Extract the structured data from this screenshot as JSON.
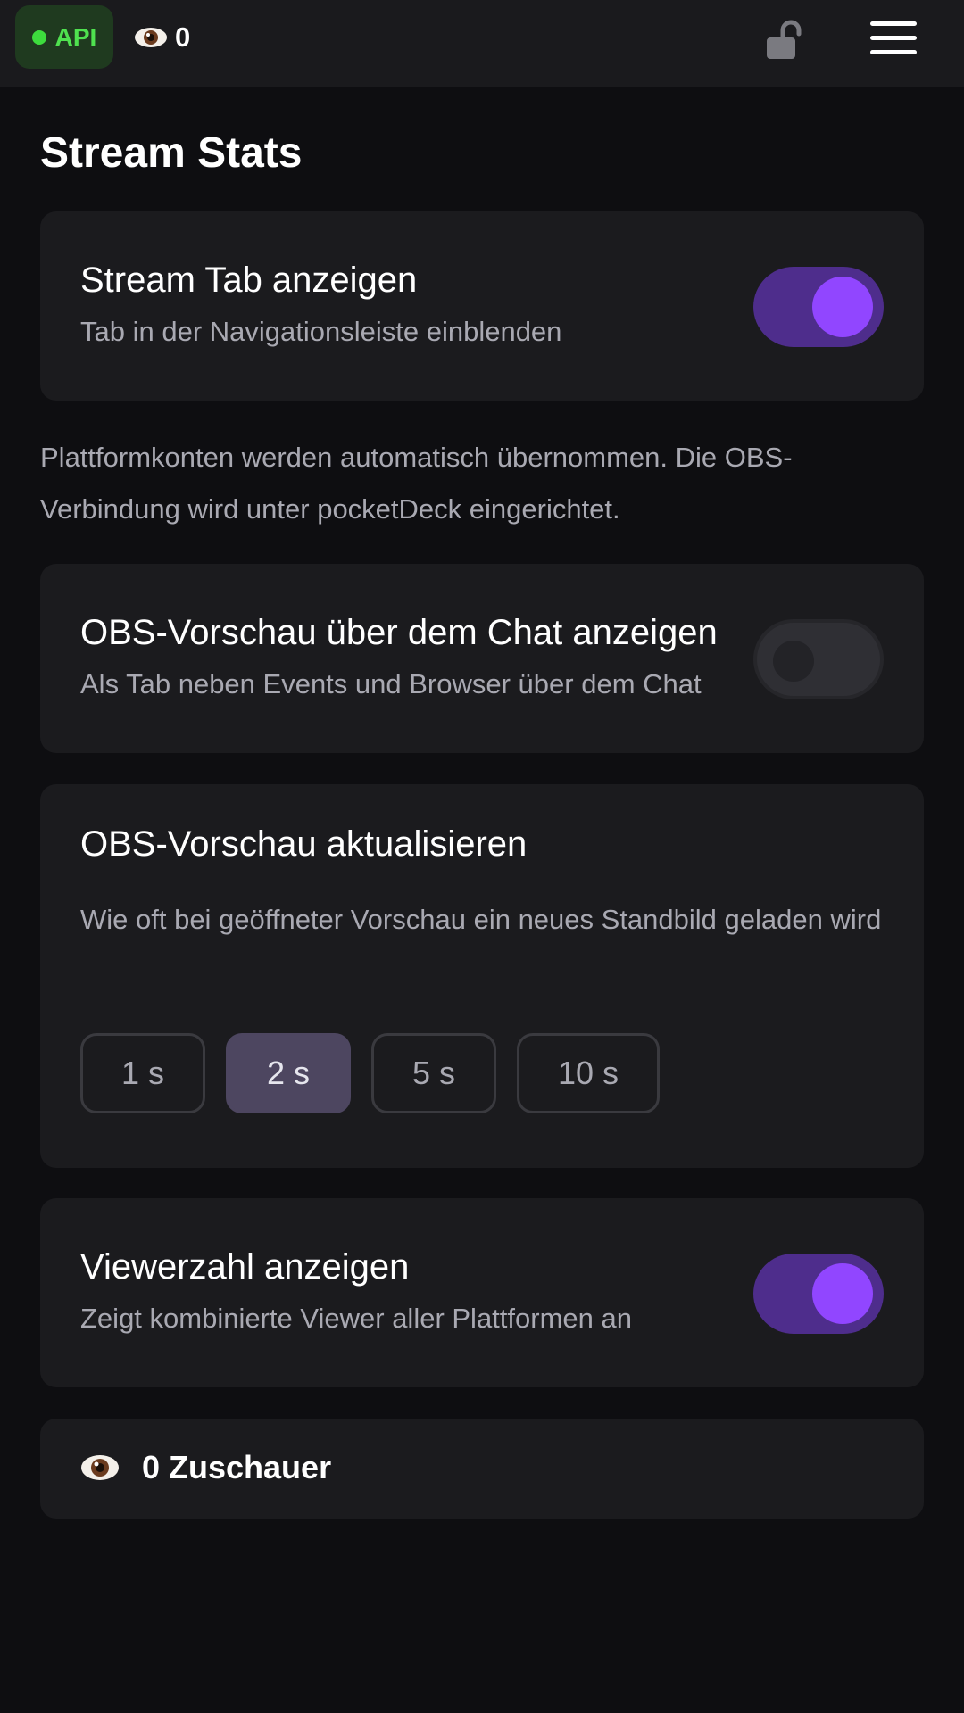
{
  "header": {
    "api_label": "API",
    "viewer_count": "0",
    "lock_icon": "lock-open-icon",
    "menu_icon": "hamburger-menu-icon"
  },
  "page": {
    "title": "Stream Stats"
  },
  "settings": {
    "stream_tab": {
      "title": "Stream Tab anzeigen",
      "subtitle": "Tab in der Navigationsleiste einblenden",
      "enabled": true
    },
    "info": "Plattformkonten werden automatisch übernommen. Die OBS-Verbindung wird unter pocketDeck eingerichtet.",
    "obs_preview": {
      "title": "OBS-Vorschau über dem Chat anzeigen",
      "subtitle": "Als Tab neben Events und Browser über dem Chat",
      "enabled": false
    },
    "obs_refresh": {
      "title": "OBS-Vorschau aktualisieren",
      "subtitle": "Wie oft bei geöffneter Vorschau ein neues Standbild geladen wird",
      "options": [
        "1 s",
        "2 s",
        "5 s",
        "10 s"
      ],
      "selected": "2 s"
    },
    "viewer_count": {
      "title": "Viewerzahl anzeigen",
      "subtitle": "Zeigt kombinierte Viewer aller Plattformen an",
      "enabled": true
    }
  },
  "viewers": {
    "label": "0 Zuschauer"
  },
  "colors": {
    "accent": "#9146ff",
    "toggle_on_track": "#4e2d8c",
    "api_green": "#4fe14f",
    "background": "#0e0e11",
    "card": "#1b1b1e"
  }
}
